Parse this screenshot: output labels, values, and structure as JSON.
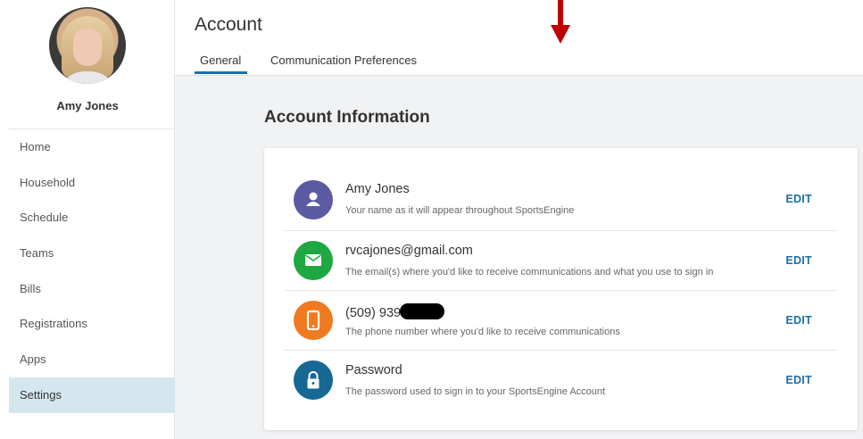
{
  "sidebar": {
    "user_name": "Amy Jones",
    "items": [
      {
        "label": "Home"
      },
      {
        "label": "Household"
      },
      {
        "label": "Schedule"
      },
      {
        "label": "Teams"
      },
      {
        "label": "Bills"
      },
      {
        "label": "Registrations"
      },
      {
        "label": "Apps"
      },
      {
        "label": "Settings",
        "active": true
      }
    ]
  },
  "header": {
    "title": "Account",
    "tabs": [
      {
        "label": "General",
        "active": true
      },
      {
        "label": "Communication Preferences"
      }
    ]
  },
  "main": {
    "section_title": "Account Information",
    "rows": [
      {
        "title": "Amy Jones",
        "description": "Your name as it will appear throughout SportsEngine",
        "edit": "EDIT",
        "icon": "person-icon",
        "color": "#5b5aa3"
      },
      {
        "title": "rvcajones@gmail.com",
        "description": "The email(s) where you'd like to receive communications and what you use to sign in",
        "edit": "EDIT",
        "icon": "envelope-icon",
        "color": "#1fa842"
      },
      {
        "title": "(509) 939-",
        "description": "The phone number where you'd like to receive communications",
        "edit": "EDIT",
        "icon": "phone-icon",
        "color": "#f07a1f"
      },
      {
        "title": "Password",
        "description": "The password used to sign in to your SportsEngine Account",
        "edit": "EDIT",
        "icon": "lock-icon",
        "color": "#176894"
      }
    ]
  },
  "colors": {
    "accent": "#1b6fa8",
    "annotation_arrow": "#c00000"
  }
}
